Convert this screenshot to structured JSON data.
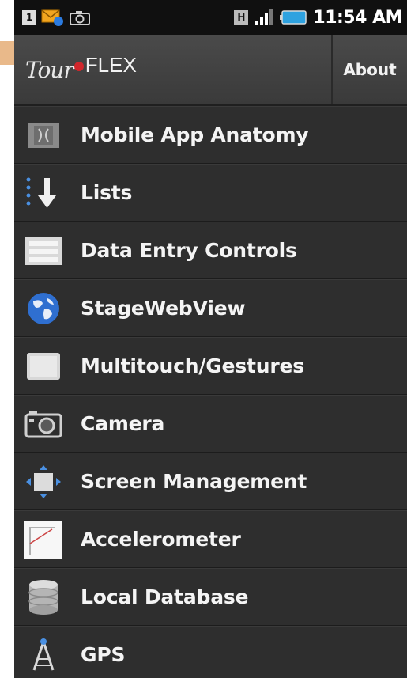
{
  "status_bar": {
    "left_badge": "1",
    "network_badge": "H",
    "time": "11:54 AM"
  },
  "action_bar": {
    "logo_script": "Tour",
    "logo_text": "FLEX",
    "about_label": "About"
  },
  "menu": {
    "items": [
      {
        "label": "Mobile App Anatomy",
        "icon": "anatomy-icon"
      },
      {
        "label": "Lists",
        "icon": "list-arrow-icon"
      },
      {
        "label": "Data Entry Controls",
        "icon": "form-icon"
      },
      {
        "label": "StageWebView",
        "icon": "globe-icon"
      },
      {
        "label": "Multitouch/Gestures",
        "icon": "touchpad-icon"
      },
      {
        "label": "Camera",
        "icon": "camera-icon"
      },
      {
        "label": "Screen Management",
        "icon": "screen-icon"
      },
      {
        "label": "Accelerometer",
        "icon": "chart-icon"
      },
      {
        "label": "Local Database",
        "icon": "database-icon"
      },
      {
        "label": "GPS",
        "icon": "antenna-icon"
      }
    ]
  },
  "colors": {
    "background": "#2e2e2e",
    "status_bar": "#101010",
    "action_bar": "#444444",
    "accent": "#e9b98a",
    "logo_dot": "#d0262b"
  }
}
